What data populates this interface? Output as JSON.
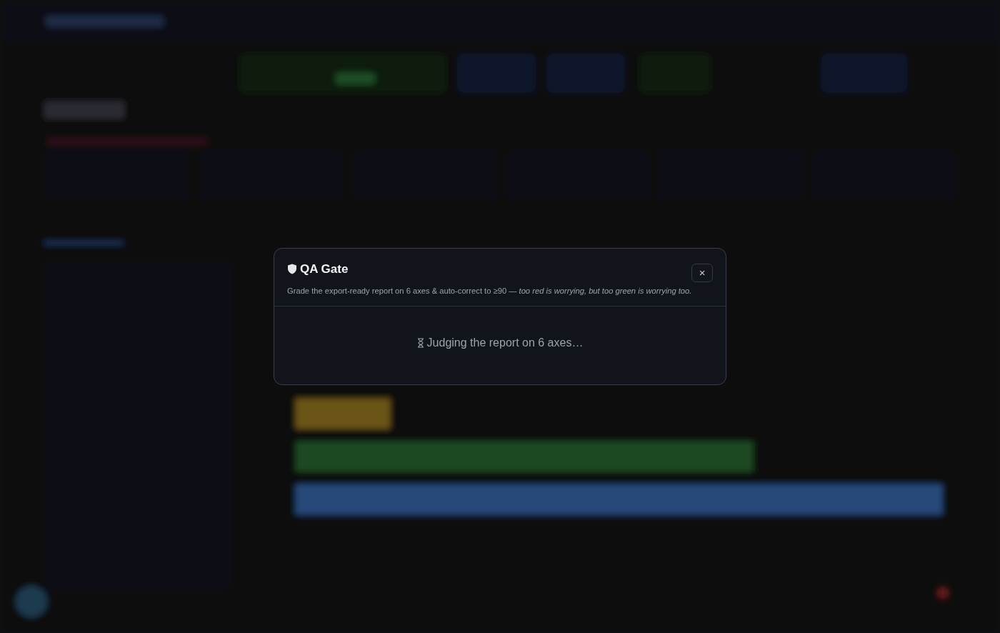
{
  "dialog": {
    "title": "QA Gate",
    "description": "Grade the export-ready report on 6 axes & auto-correct to ≥90 — *too red is worrying, but too green is worrying too.*",
    "close_label": "×",
    "status": "Judging the report on 6 axes…"
  }
}
